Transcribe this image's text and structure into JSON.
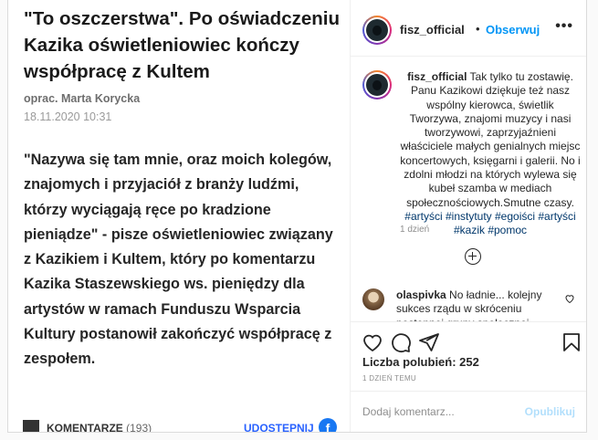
{
  "article": {
    "title": "\"To oszczerstwa\". Po oświadczeniu Kazika oświetleniowiec kończy współpracę z Kultem",
    "author_prefix": "oprac.",
    "author": "Marta Korycka",
    "date": "18.11.2020 10:31",
    "body": "\"Nazywa się tam mnie, oraz moich kolegów, znajomych i przyjaciół z branży ludźmi, którzy wyciągają ręce po kradzione pieniądze\" - pisze oświetleniowiec związany z Kazikiem i Kultem, który po komentarzu Kazika Staszewskiego ws. pieniędzy dla artystów w ramach Funduszu Wsparcia Kultury postanowił zakończyć współpracę z zespołem.",
    "comments_label": "KOMENTARZE",
    "comments_count": "(193)",
    "share_label": "UDOSTĘPNIJ",
    "fb_icon": "f"
  },
  "header": {
    "username": "fisz_official",
    "separator": "•",
    "follow_label": "Obserwuj",
    "more_label": "•••"
  },
  "caption": {
    "username": "fisz_official",
    "text": "Tak tylko tu zostawię. Panu Kazikowi dziękuje też nasz wspólny kierowca, świetlik Tworzywa, znajomi muzycy i nasi tworzywowi, zaprzyjaźnieni właściciele małych genialnych miejsc koncertowych, księgarni i galerii. No i zdolni młodzi na których wylewa się kubeł szamba w mediach społecznościowych.Smutne czasy.",
    "hashtags": "#artyści #instytuty #egoiści #artyści #kazik #pomoc",
    "time": "1 dzień"
  },
  "comment": {
    "username": "olaspivka",
    "text": "No ładnie... kolejny sukces rządu w skróceniu postępnej grupy społecznej"
  },
  "actions": {
    "icons": [
      "heart-icon",
      "comment-icon",
      "share-icon",
      "bookmark-icon"
    ],
    "likes_label": "Liczba polubień: 252",
    "post_time": "1 DZIEŃ TEMU"
  },
  "add_comment": {
    "placeholder": "Dodaj komentarz...",
    "post_label": "Opublikuj"
  },
  "colors": {
    "accent": "#0095f6",
    "hashtag": "#00376b",
    "post_disabled": "#b2dffc",
    "share_blue": "#2962ff"
  }
}
